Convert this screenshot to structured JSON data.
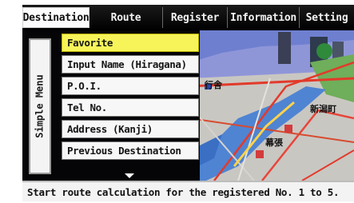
{
  "tabs": [
    {
      "label": "Destination",
      "active": true
    },
    {
      "label": "Route",
      "active": false
    },
    {
      "label": "Register",
      "active": false
    },
    {
      "label": "Information",
      "active": false
    },
    {
      "label": "Setting",
      "active": false
    }
  ],
  "side_tab": {
    "label": "Simple Menu"
  },
  "menu": {
    "items": [
      {
        "label": "Favorite",
        "selected": true
      },
      {
        "label": "Input Name (Hiragana)",
        "selected": false
      },
      {
        "label": "P.O.I.",
        "selected": false
      },
      {
        "label": "Tel No.",
        "selected": false
      },
      {
        "label": "Address (Kanji)",
        "selected": false
      },
      {
        "label": "Previous Destination",
        "selected": false
      }
    ],
    "scroll_icon": "chevron-down-icon"
  },
  "map": {
    "labels": [
      "新潟町",
      "行舎",
      "幕張"
    ]
  },
  "status": {
    "text": "Start route calculation for the registered No. 1 to 5."
  },
  "colors": {
    "selected_item": "#f7f45a",
    "tab_bar": "#000000",
    "active_tab": "#fbfbfb",
    "status_bar": "#f3f3f3"
  }
}
